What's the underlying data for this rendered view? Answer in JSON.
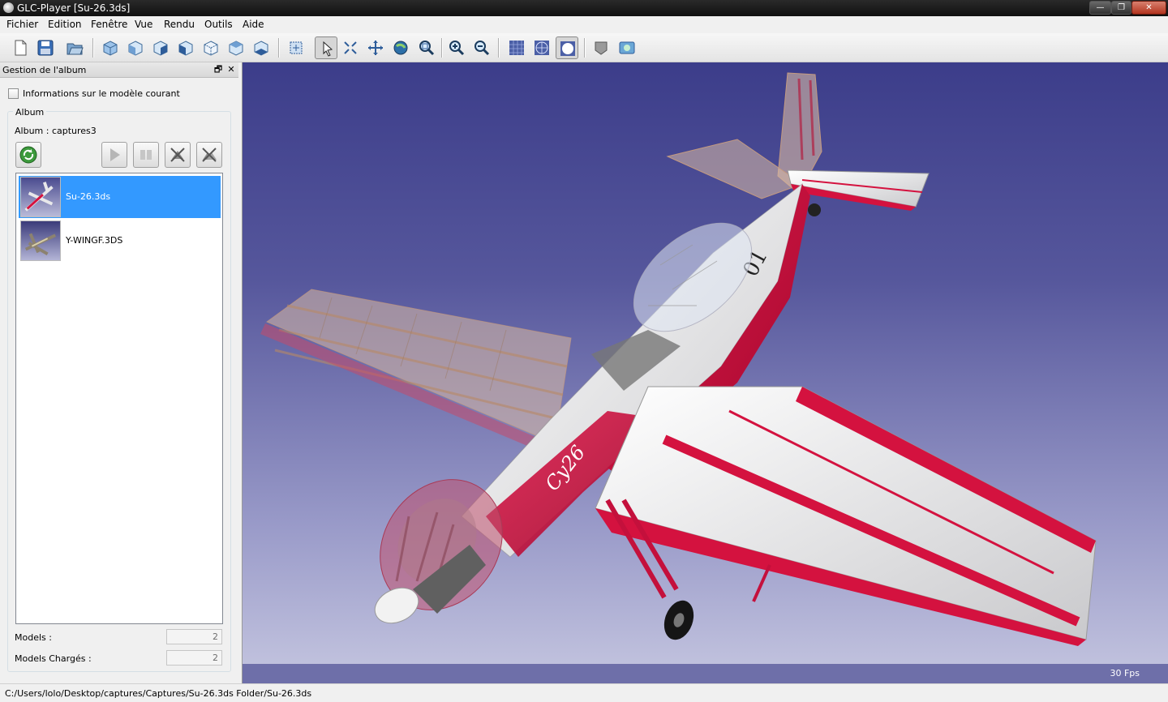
{
  "window": {
    "title": "GLC-Player [Su-26.3ds]",
    "minimize_label": "—",
    "maximize_label": "❐",
    "close_label": "✕"
  },
  "menubar": [
    "Fichier",
    "Edition",
    "Fenêtre",
    "Vue",
    "Rendu",
    "Outils",
    "Aide"
  ],
  "toolbar": {
    "groups": [
      [
        "new-file-icon",
        "save-icon",
        "open-folder-icon"
      ],
      [
        "view-iso-icon",
        "view-front-icon",
        "view-right-icon",
        "view-left-icon",
        "view-back-icon",
        "view-top-icon",
        "view-bottom-icon"
      ],
      [
        "reframe-icon",
        "select-icon",
        "fit-all-icon",
        "pan-icon",
        "orbit-icon",
        "zoom-window-icon",
        "zoom-in-icon",
        "zoom-out-icon"
      ],
      [
        "wireframe-icon",
        "hidden-lines-icon",
        "shaded-icon"
      ],
      [
        "material-icon",
        "snapshot-icon"
      ]
    ],
    "pressed": [
      "select-icon",
      "shaded-icon"
    ]
  },
  "dock": {
    "title": "Gestion de l'album",
    "float_label": "🗗",
    "close_label": "✕",
    "info_checkbox_label": "Informations sur le modèle courant",
    "info_checked": false,
    "group_title": "Album",
    "album_label": "Album : captures3",
    "buttons": [
      "refresh-icon",
      "play-icon",
      "pause-icon",
      "remove-icon",
      "remove-all-icon"
    ],
    "items": [
      {
        "name": "Su-26.3ds",
        "selected": true
      },
      {
        "name": "Y-WINGF.3DS",
        "selected": false
      }
    ],
    "models_label": "Models :",
    "models_value": "2",
    "loaded_label": "Models Chargés :",
    "loaded_value": "2"
  },
  "viewport": {
    "fps": "30 Fps",
    "fuselage_number": "01",
    "fuselage_marking": "Cy26",
    "colors": {
      "sky_top": "#3c3d8a",
      "sky_bottom": "#c5c6e0",
      "plane_red": "#d4123f",
      "plane_white": "#e8e8ea"
    }
  },
  "status": {
    "path": "C:/Users/lolo/Desktop/captures/Captures/Su-26.3ds Folder/Su-26.3ds"
  }
}
